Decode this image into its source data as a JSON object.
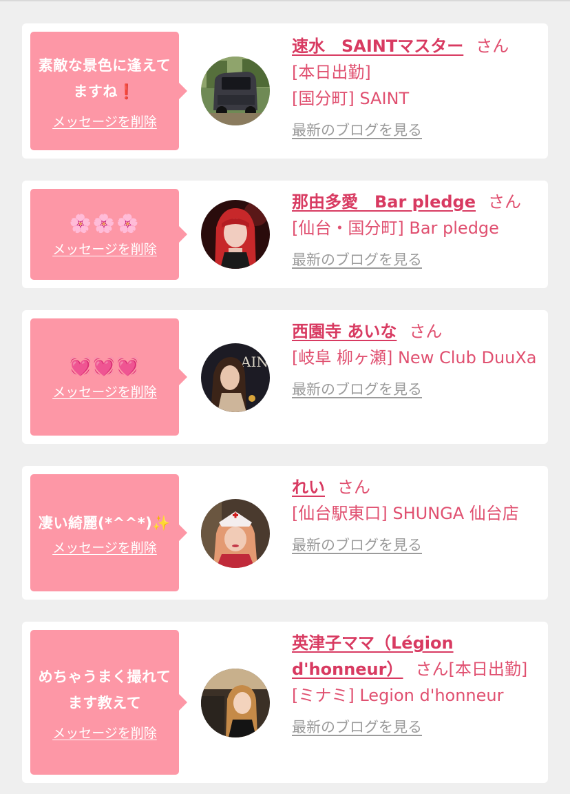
{
  "messages": [
    {
      "message": "素敵な景色に逢えてますね",
      "message_emoji": "❗",
      "delete_label": "メッセージを削除",
      "name": "速水　SAINTマスター",
      "honorific": "さん",
      "status": "[本日出勤]",
      "shop": "[国分町] SAINT",
      "blog_label": "最新のブログを見る"
    },
    {
      "message": "🌸🌸🌸",
      "delete_label": "メッセージを削除",
      "name": "那由多愛　Bar pledge",
      "honorific": "さん",
      "shop": "[仙台・国分町] Bar pledge",
      "blog_label": "最新のブログを見る"
    },
    {
      "message": "💓💓💓",
      "delete_label": "メッセージを削除",
      "name": "西園寺 あいな",
      "honorific": "さん",
      "shop": "[岐阜 柳ヶ瀬] New Club DuuXa",
      "blog_label": "最新のブログを見る"
    },
    {
      "message": "凄い綺麗(*^^*)",
      "message_emoji": "✨",
      "delete_label": "メッセージを削除",
      "name": "れい",
      "honorific": "さん",
      "shop": "[仙台駅東口] SHUNGA 仙台店",
      "blog_label": "最新のブログを見る"
    },
    {
      "message": "めちゃうまく撮れてます教えて",
      "delete_label": "メッセージを削除",
      "name": "英津子ママ（Légion d'honneur）",
      "honorific": "さん",
      "status": "[本日出勤]",
      "shop": "[ミナミ] Legion d'honneur",
      "blog_label": "最新のブログを見る"
    }
  ],
  "colors": {
    "bubble": "#fd97a6",
    "name": "#d83a61",
    "text": "#e05070",
    "link_gray": "#9b9b9b",
    "background": "#efefef"
  }
}
